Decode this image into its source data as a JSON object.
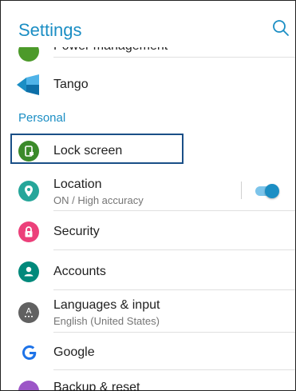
{
  "header": {
    "title": "Settings",
    "search_icon": "search-icon"
  },
  "items": {
    "power": {
      "label": "Power management",
      "icon": "power-icon",
      "color": "#4c9a2a"
    },
    "tango": {
      "label": "Tango",
      "icon": "tango-icon",
      "color": "#1b8ec4"
    },
    "lock": {
      "label": "Lock screen",
      "icon": "lock-screen-icon",
      "color": "#3b8a2a"
    },
    "location": {
      "label": "Location",
      "sub": "ON / High accuracy",
      "icon": "location-icon",
      "color": "#26a69a",
      "toggle_on": true
    },
    "security": {
      "label": "Security",
      "icon": "security-icon",
      "color": "#ec407a"
    },
    "accounts": {
      "label": "Accounts",
      "icon": "accounts-icon",
      "color": "#00897b"
    },
    "languages": {
      "label": "Languages & input",
      "sub": "English (United States)",
      "icon": "languages-icon",
      "color": "#616161"
    },
    "google": {
      "label": "Google",
      "icon": "google-icon",
      "color": "#1e73e8"
    },
    "backup": {
      "label": "Backup & reset",
      "icon": "backup-icon",
      "color": "#9c56c7"
    }
  },
  "sections": {
    "personal": "Personal"
  },
  "colors": {
    "accent": "#1b8ec4",
    "highlight": "#1a4f87"
  }
}
